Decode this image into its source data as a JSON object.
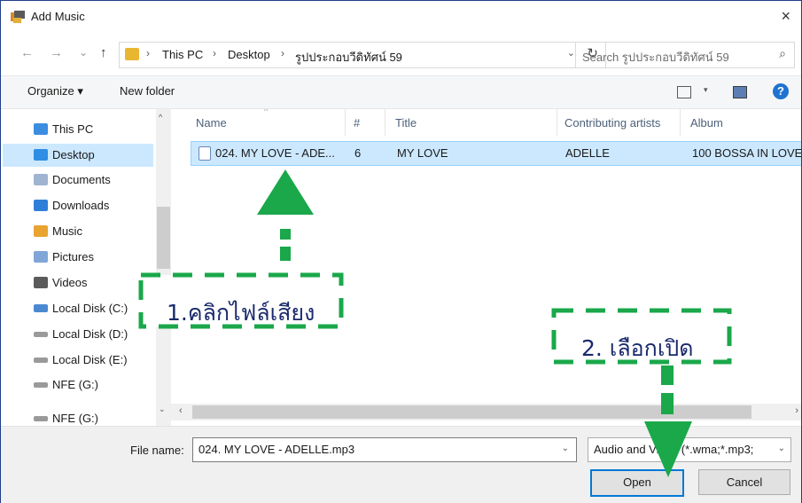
{
  "window": {
    "title": "Add Music",
    "close_glyph": "×"
  },
  "nav": {
    "back": "←",
    "forward": "→",
    "recent": "⌄",
    "up": "↑"
  },
  "address": {
    "crumbs": [
      "This PC",
      "Desktop",
      "รูปประกอบวีดิทัศน์ 59"
    ],
    "sep": "›",
    "dropdown": "⌄",
    "refresh": "↻"
  },
  "search": {
    "placeholder": "Search รูปประกอบวีดิทัศน์ 59",
    "icon": "⌕"
  },
  "toolbar": {
    "organize": "Organize ▾",
    "new_folder": "New folder",
    "dropdown": "▾",
    "help": "?"
  },
  "sidebar": {
    "items": [
      {
        "label": "This PC",
        "icon": "computer-icon",
        "color": "#3b8de0"
      },
      {
        "label": "Desktop",
        "icon": "desktop-folder-icon",
        "color": "#2f8de4"
      },
      {
        "label": "Documents",
        "icon": "documents-icon",
        "color": "#9fb4d1"
      },
      {
        "label": "Downloads",
        "icon": "downloads-icon",
        "color": "#2f7fd8"
      },
      {
        "label": "Music",
        "icon": "music-icon",
        "color": "#e8a331"
      },
      {
        "label": "Pictures",
        "icon": "pictures-icon",
        "color": "#7fa6d6"
      },
      {
        "label": "Videos",
        "icon": "videos-icon",
        "color": "#5b5b5b"
      },
      {
        "label": "Local Disk (C:)",
        "icon": "system-disk-icon",
        "color": "#4b8ad0"
      },
      {
        "label": "Local Disk (D:)",
        "icon": "disk-icon",
        "color": "#9a9a9a"
      },
      {
        "label": "Local Disk (E:)",
        "icon": "disk-icon",
        "color": "#9a9a9a"
      },
      {
        "label": "NFE (G:)",
        "icon": "disk-icon",
        "color": "#9a9a9a"
      },
      {
        "label": "NFE (G:)",
        "icon": "disk-icon",
        "color": "#9a9a9a"
      }
    ]
  },
  "file_list": {
    "columns": [
      "Name",
      "#",
      "Title",
      "Contributing artists",
      "Album"
    ],
    "sort_glyph": "^",
    "rows": [
      {
        "name": "024. MY LOVE - ADE...",
        "number": "6",
        "title": "MY LOVE",
        "artist": "ADELLE",
        "album": "100 BOSSA IN LOVE"
      }
    ]
  },
  "scroll": {
    "up": "^",
    "down": "⌄",
    "left": "‹",
    "right": "›"
  },
  "footer": {
    "file_name_label": "File name:",
    "file_name_value": "024. MY LOVE - ADELLE.mp3",
    "file_type_value": "Audio and Video (*.wma;*.mp3;",
    "dropdown": "⌄",
    "open_label": "Open",
    "cancel_label": "Cancel"
  },
  "annotations": {
    "step1": "1.คลิกไฟล์เสียง",
    "step2": "2. เลือกเปิด",
    "color": "#1aa84a"
  }
}
